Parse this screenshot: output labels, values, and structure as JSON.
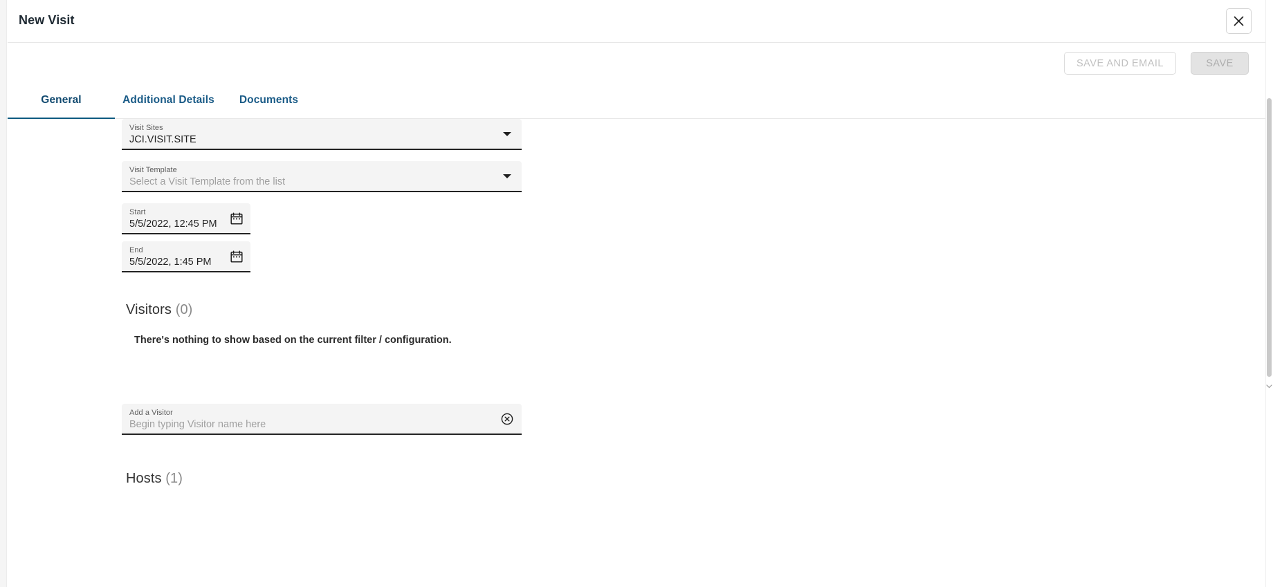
{
  "window": {
    "title": "New Visit",
    "close_icon": "close-icon"
  },
  "actions": {
    "save_and_email_label": "SAVE AND EMAIL",
    "save_label": "SAVE"
  },
  "tabs": [
    {
      "label": "General",
      "active": true
    },
    {
      "label": "Additional Details",
      "active": false
    },
    {
      "label": "Documents",
      "active": false
    }
  ],
  "form": {
    "visit_sites": {
      "label": "Visit Sites",
      "value": "JCI.VISIT.SITE",
      "caret_icon": "chevron-down-icon"
    },
    "visit_template": {
      "label": "Visit Template",
      "value": "",
      "placeholder": "Select a Visit Template from the list",
      "caret_icon": "chevron-down-icon"
    },
    "start": {
      "label": "Start",
      "value": "5/5/2022, 12:45 PM",
      "icon": "calendar-icon"
    },
    "end": {
      "label": "End",
      "value": "5/5/2022, 1:45 PM",
      "icon": "calendar-icon"
    },
    "add_visitor": {
      "label": "Add a Visitor",
      "value": "",
      "placeholder": "Begin typing Visitor name here",
      "clear_icon": "clear-circle-icon"
    }
  },
  "sections": {
    "visitors": {
      "title": "Visitors",
      "count": "(0)",
      "empty_message": "There's nothing to show based on the current filter / configuration."
    },
    "hosts": {
      "title": "Hosts",
      "count": "(1)"
    }
  },
  "colors": {
    "tab_active": "#0e5a80",
    "tab_text": "#1a5b87",
    "field_bg": "#f4f4f4",
    "field_underline": "#232323",
    "save_disabled_bg": "#e3e3e3"
  }
}
